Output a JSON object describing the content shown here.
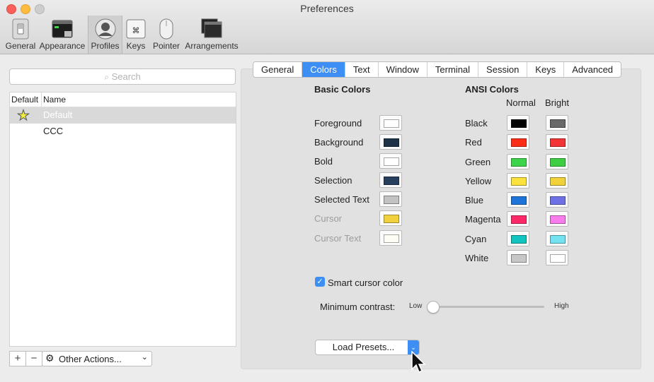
{
  "window": {
    "title": "Preferences"
  },
  "toolbar": {
    "items": [
      {
        "label": "General"
      },
      {
        "label": "Appearance"
      },
      {
        "label": "Profiles"
      },
      {
        "label": "Keys"
      },
      {
        "label": "Pointer"
      },
      {
        "label": "Arrangements"
      }
    ],
    "active": "Profiles"
  },
  "profiles": {
    "search_placeholder": "Search",
    "col_default": "Default",
    "col_name": "Name",
    "rows": [
      {
        "name": "Default",
        "is_default": true,
        "selected": true
      },
      {
        "name": "CCC",
        "is_default": false,
        "selected": false
      }
    ],
    "add_label": "+",
    "remove_label": "−",
    "other_actions_label": "Other Actions..."
  },
  "tabs": [
    "General",
    "Colors",
    "Text",
    "Window",
    "Terminal",
    "Session",
    "Keys",
    "Advanced"
  ],
  "active_tab": "Colors",
  "basic": {
    "header": "Basic Colors",
    "items": [
      {
        "label": "Foreground",
        "color": "#ffffff",
        "enabled": true
      },
      {
        "label": "Background",
        "color": "#1e3247",
        "enabled": true
      },
      {
        "label": "Bold",
        "color": "#ffffff",
        "enabled": true
      },
      {
        "label": "Selection",
        "color": "#26405e",
        "enabled": true
      },
      {
        "label": "Selected Text",
        "color": "#c2c2c2",
        "enabled": true
      },
      {
        "label": "Cursor",
        "color": "#f1d13e",
        "enabled": false
      },
      {
        "label": "Cursor Text",
        "color": "#fdfdf4",
        "enabled": false
      }
    ]
  },
  "ansi": {
    "header": "ANSI Colors",
    "normal_label": "Normal",
    "bright_label": "Bright",
    "items": [
      {
        "label": "Black",
        "normal": "#000000",
        "bright": "#686868"
      },
      {
        "label": "Red",
        "normal": "#fe2d17",
        "bright": "#f23534"
      },
      {
        "label": "Green",
        "normal": "#3dd34a",
        "bright": "#3dce43"
      },
      {
        "label": "Yellow",
        "normal": "#fbe23d",
        "bright": "#f2d23b"
      },
      {
        "label": "Blue",
        "normal": "#1e74d8",
        "bright": "#6e71e6"
      },
      {
        "label": "Magenta",
        "normal": "#ff2868",
        "bright": "#f97cec"
      },
      {
        "label": "Cyan",
        "normal": "#12c4c0",
        "bright": "#74e2f0"
      },
      {
        "label": "White",
        "normal": "#c7c7c7",
        "bright": "#ffffff"
      }
    ]
  },
  "smart_cursor": {
    "label": "Smart cursor color",
    "checked": true
  },
  "contrast": {
    "label": "Minimum contrast:",
    "low": "Low",
    "high": "High",
    "value": 0
  },
  "presets": {
    "label": "Load Presets..."
  },
  "colors": {
    "accent": "#3d8ef5"
  }
}
